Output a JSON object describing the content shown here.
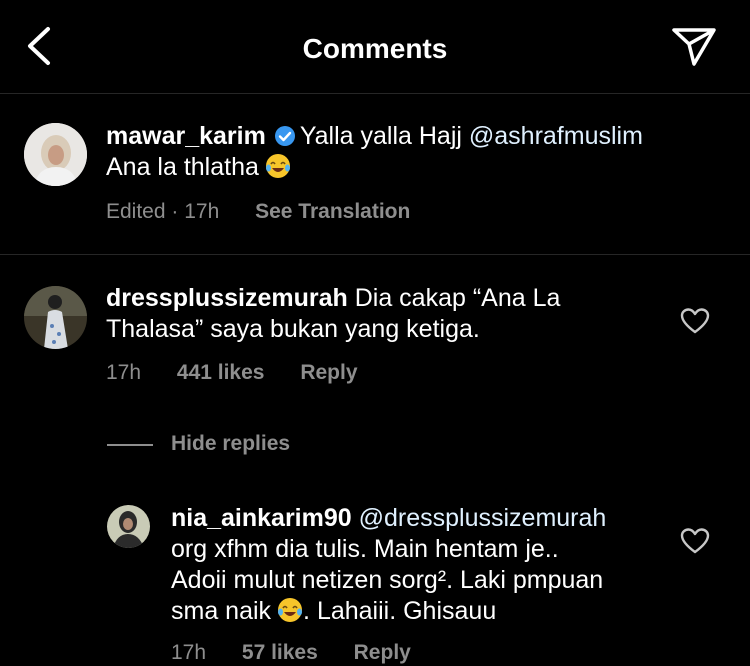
{
  "header": {
    "title": "Comments",
    "back_icon": "chevron-left-icon",
    "send_icon": "paper-plane-icon"
  },
  "caption": {
    "username": "mawar_karim",
    "verified_icon": "verified-badge-icon",
    "text_line1": "Yalla yalla Hajj",
    "mention": "@ashrafmuslim",
    "text_line2": "Ana la thlatha",
    "emoji": "laughing-tears-emoji",
    "meta_time": "Edited · 17h",
    "see_translation": "See Translation"
  },
  "comment": {
    "username": "dressplussizemurah",
    "text_line1": "Dia cakap “Ana La",
    "text_line2": "Thalasa” saya bukan yang ketiga.",
    "time": "17h",
    "likes": "441 likes",
    "reply": "Reply"
  },
  "replies_toggle": "Hide replies",
  "reply": {
    "username": "nia_ainkarim90",
    "mention": "@dressplussizemurah",
    "line2": "org xfhm dia tulis. Main hentam je..",
    "line3": "Adoii mulut netizen sorg². Laki pmpuan",
    "line4_a": "sma naik",
    "line4_b": ". Lahaiii. Ghisauu",
    "time": "17h",
    "likes": "57 likes",
    "reply": "Reply"
  },
  "colors": {
    "background": "#000000",
    "secondary_text": "#8e8e8e",
    "verified": "#3897f0",
    "divider": "#262626"
  }
}
